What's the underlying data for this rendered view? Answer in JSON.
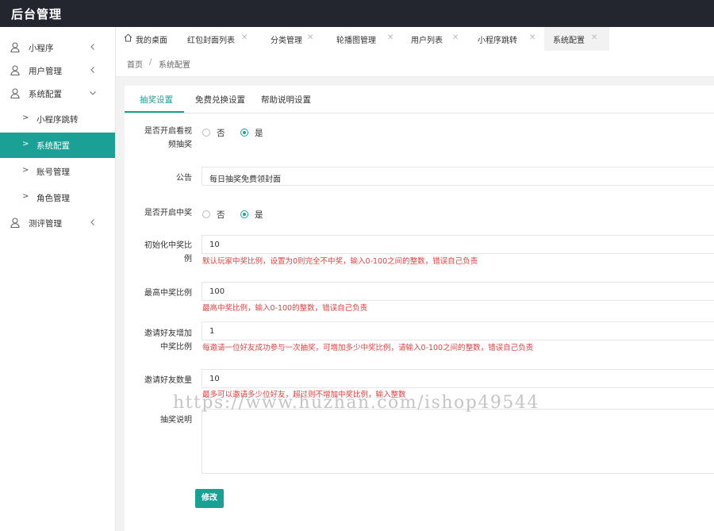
{
  "app": {
    "title": "后台管理"
  },
  "sidebar": {
    "items": [
      {
        "label": "小程序",
        "icon": "user-icon",
        "chevron": "chevron-left-icon"
      },
      {
        "label": "用户管理",
        "icon": "user-icon",
        "chevron": "chevron-left-icon"
      },
      {
        "label": "系统配置",
        "icon": "user-icon",
        "chevron": "chevron-down-icon"
      },
      {
        "label": "小程序跳转",
        "sub": true
      },
      {
        "label": "系统配置",
        "sub": true,
        "active": true
      },
      {
        "label": "账号管理",
        "sub": true
      },
      {
        "label": "角色管理",
        "sub": true
      },
      {
        "label": "测评管理",
        "icon": "user-icon",
        "chevron": "chevron-left-icon"
      }
    ],
    "sub_arrow": ">"
  },
  "tabs": [
    {
      "label": "我的桌面"
    },
    {
      "label": "红包封面列表"
    },
    {
      "label": "分类管理"
    },
    {
      "label": "轮播图管理"
    },
    {
      "label": "用户列表"
    },
    {
      "label": "小程序跳转"
    },
    {
      "label": "系统配置"
    }
  ],
  "tab_close": "✕",
  "breadcrumb": {
    "home": "首页",
    "sep": "/",
    "current": "系统配置"
  },
  "settings_tabs": [
    "抽奖设置",
    "免费兑换设置",
    "帮助说明设置"
  ],
  "form": {
    "video_lottery": {
      "label_line1": "是否开启看视",
      "label_line2": "频抽奖",
      "option_no": "否",
      "option_yes": "是",
      "selected": "是"
    },
    "notice": {
      "label": "公告",
      "value": "每日抽奖免费领封面"
    },
    "win_enabled": {
      "label": "是否开启中奖",
      "option_no": "否",
      "option_yes": "是",
      "selected": "是"
    },
    "initial_rate": {
      "label_line1": "初始化中奖比",
      "label_line2": "例",
      "value": "10",
      "hint": "默认玩家中奖比例，设置为0则完全不中奖，输入0-100之间的整数，错误自己负责"
    },
    "max_rate": {
      "label": "最高中奖比例",
      "value": "100",
      "hint": "最高中奖比例，输入0-100的整数，错误自己负责"
    },
    "invite_increase": {
      "label_line1": "邀请好友增加",
      "label_line2": "中奖比例",
      "value": "1",
      "hint": "每邀请一位好友成功参与一次抽奖，可增加多少中奖比例，请输入0-100之间的整数，错误自己负责"
    },
    "invite_count": {
      "label": "邀请好友数量",
      "value": "10",
      "hint": "最多可以邀请多少位好友，超过则不增加中奖比例，输入整数"
    },
    "description": {
      "label": "抽奖说明",
      "value": ""
    },
    "submit_label": "修改"
  },
  "watermark": "https://www.huzhan.com/ishop49544",
  "colors": {
    "accent": "#1aa094",
    "topbar": "#23262e",
    "hint": "#e54040"
  }
}
